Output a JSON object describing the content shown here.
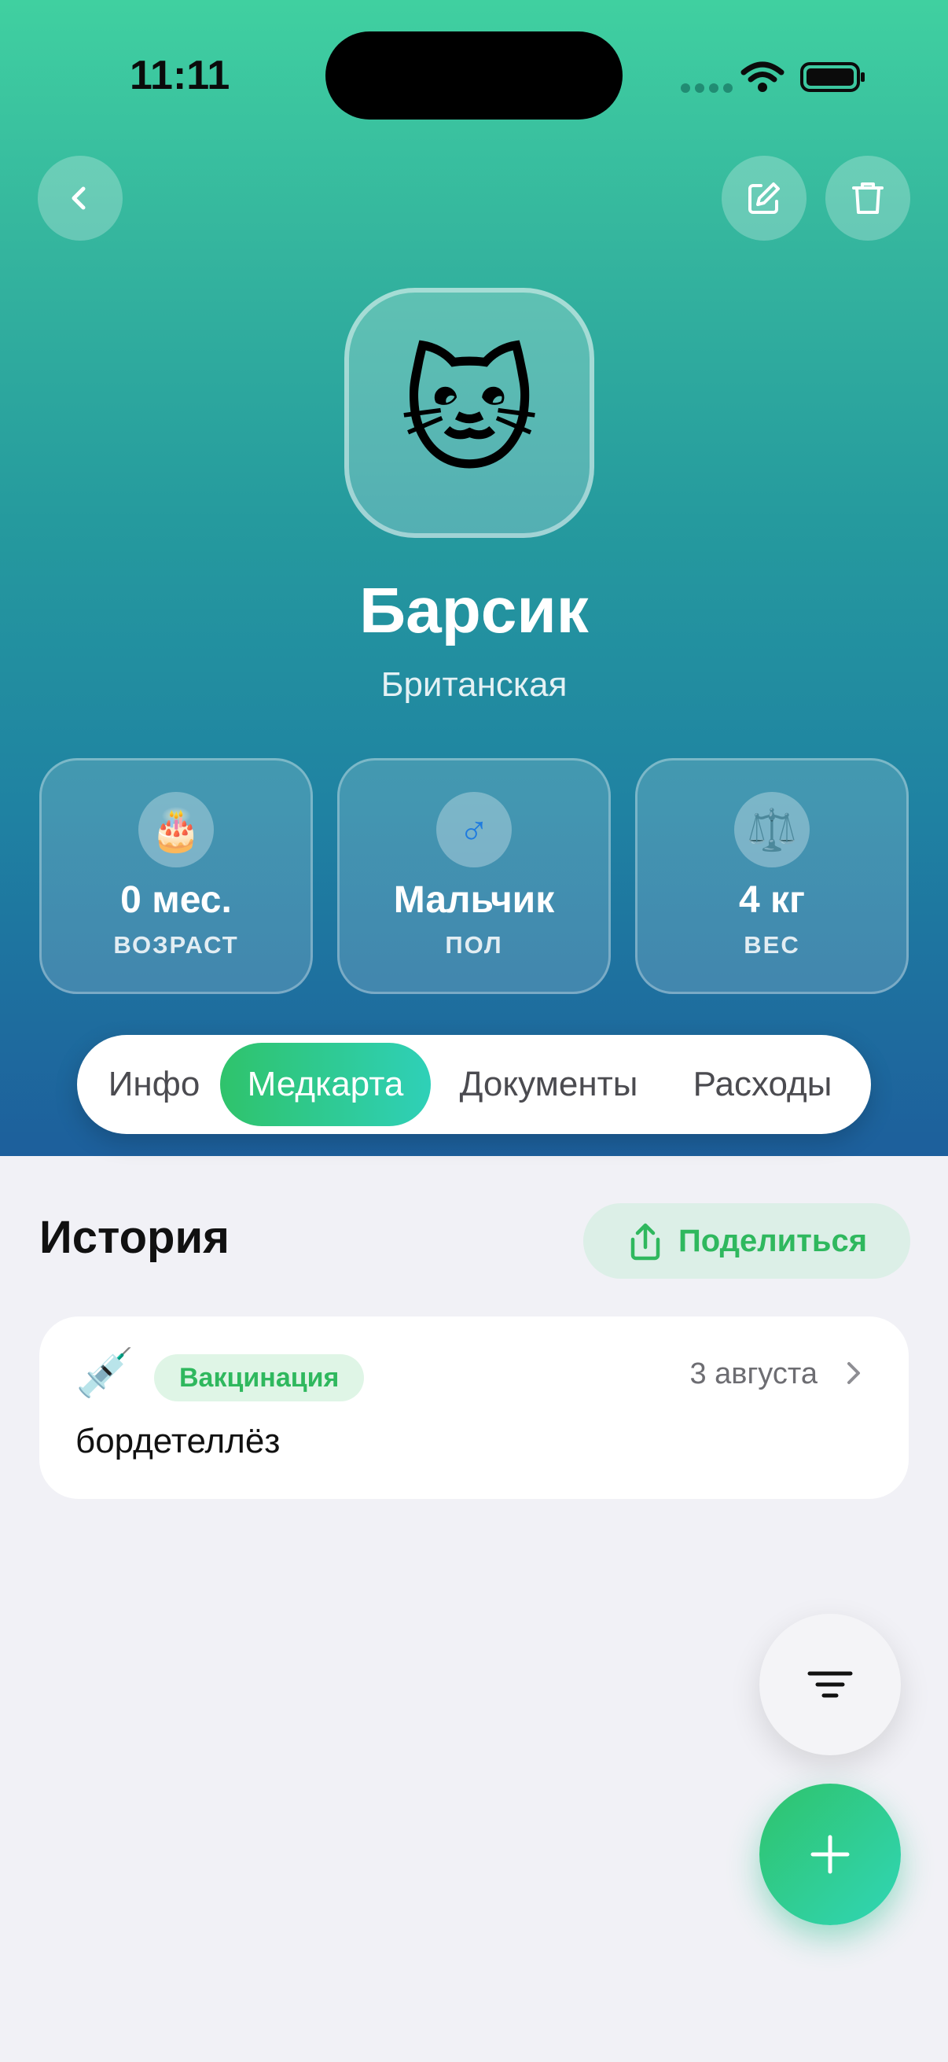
{
  "status_bar": {
    "time": "11:11"
  },
  "header": {
    "back_icon": "chevron-left-icon",
    "edit_icon": "edit-icon",
    "delete_icon": "trash-icon"
  },
  "pet": {
    "avatar_emoji": "🐱",
    "name": "Барсик",
    "breed": "Британская"
  },
  "stats": [
    {
      "icon": "🎂",
      "value": "0 мес.",
      "label": "ВОЗРАСТ"
    },
    {
      "icon": "♂",
      "value": "Мальчик",
      "label": "ПОЛ"
    },
    {
      "icon": "⚖️",
      "value": "4 кг",
      "label": "ВЕС"
    }
  ],
  "tabs": [
    {
      "label": "Инфо",
      "active": false
    },
    {
      "label": "Медкарта",
      "active": true
    },
    {
      "label": "Документы",
      "active": false
    },
    {
      "label": "Расходы",
      "active": false
    }
  ],
  "history": {
    "title": "История",
    "share_label": "Поделиться",
    "records": [
      {
        "icon": "💉",
        "category": "Вакцинация",
        "date": "3 августа",
        "title": "бордетеллёз"
      }
    ]
  },
  "colors": {
    "accent_green": "#2fb85e",
    "gradient_top": "#40d0a0",
    "gradient_bottom": "#1d5f9c"
  }
}
